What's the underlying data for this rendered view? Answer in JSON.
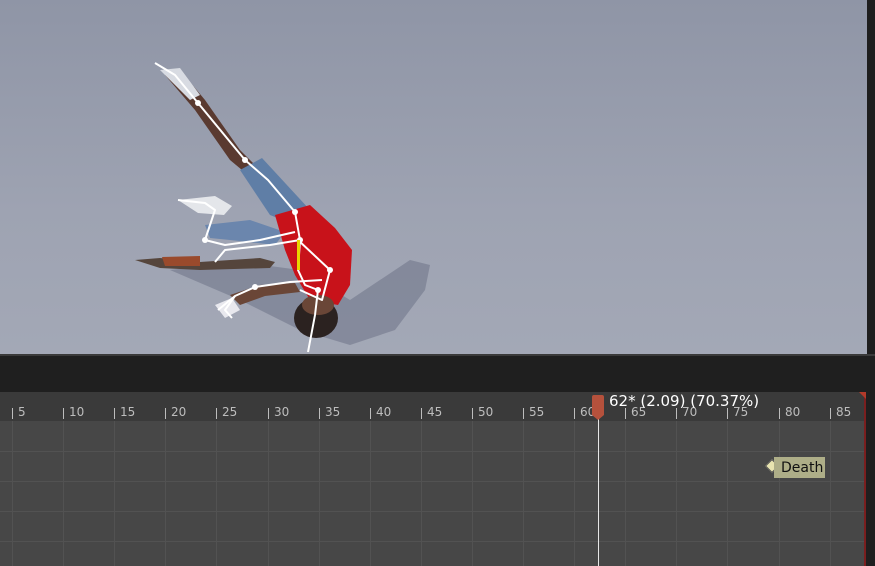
{
  "timeline": {
    "tick_labels": [
      "5",
      "10",
      "15",
      "20",
      "25",
      "30",
      "35",
      "40",
      "45",
      "50",
      "55",
      "60",
      "65",
      "70",
      "75",
      "80",
      "85"
    ],
    "playhead": {
      "frame": 62,
      "readout": "62* (2.09) (70.37%)"
    },
    "notify": {
      "label": "Death"
    }
  },
  "colors": {
    "viewport_bg": "#9ea3b2",
    "timeline_bg": "#474747",
    "playhead_handle": "#b5513c",
    "notify_bg": "#aeae88",
    "end_marker": "#b23a2a"
  }
}
